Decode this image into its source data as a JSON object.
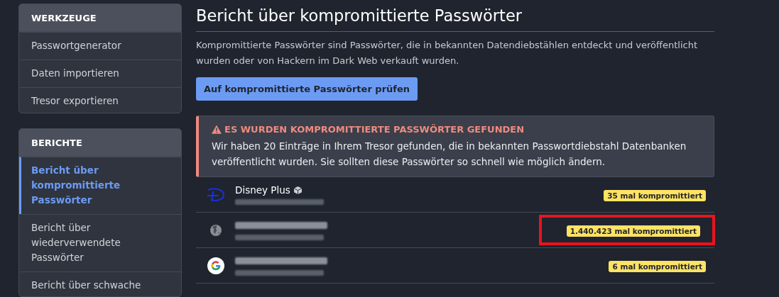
{
  "sidebar": [
    {
      "title": "WERKZEUGE",
      "items": [
        {
          "label": "Passwortgenerator",
          "selected": false
        },
        {
          "label": "Daten importieren",
          "selected": false
        },
        {
          "label": "Tresor exportieren",
          "selected": false
        }
      ]
    },
    {
      "title": "BERICHTE",
      "items": [
        {
          "label": "Bericht über kompromittierte Passwörter",
          "selected": true
        },
        {
          "label": "Bericht über wiederverwendete Passwörter",
          "selected": false
        },
        {
          "label": "Bericht über schwache",
          "selected": false
        }
      ]
    }
  ],
  "page": {
    "title": "Bericht über kompromittierte Passwörter",
    "description": "Kompromittierte Passwörter sind Passwörter, die in bekannten Datendiebstählen entdeckt und veröffentlicht wurden oder von Hackern im Dark Web verkauft wurden.",
    "button": "Auf kompromittierte Passwörter prüfen"
  },
  "alert": {
    "title": "ES WURDEN KOMPROMITTIERTE PASSWÖRTER GEFUNDEN",
    "text": "Wir haben 20 Einträge in Ihrem Tresor gefunden, die in bekannten Passwortdiebstahl Datenbanken veröffentlicht wurden. Sie sollten diese Passwörter so schnell wie möglich ändern."
  },
  "entries": [
    {
      "kind": "script",
      "name": "Disney Plus",
      "shared": true,
      "badge": "35 mal kompromittiert",
      "highlighted": false
    },
    {
      "kind": "globe",
      "shared": false,
      "badge": "1.440.423 mal kompromittiert",
      "highlighted": true
    },
    {
      "kind": "gee",
      "shared": false,
      "badge": "6 mal kompromittiert",
      "highlighted": false
    }
  ]
}
